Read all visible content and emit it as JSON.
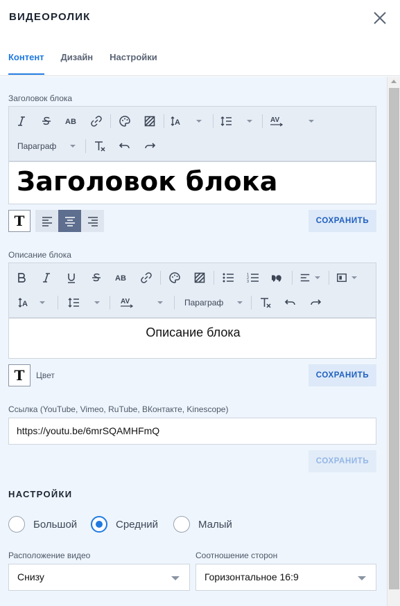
{
  "header": {
    "title": "ВИДЕОРОЛИК",
    "tabs": [
      {
        "label": "Контент",
        "active": true
      },
      {
        "label": "Дизайн",
        "active": false
      },
      {
        "label": "Настройки",
        "active": false
      }
    ]
  },
  "heading_block": {
    "label": "Заголовок блока",
    "paragraph_select": "Параграф",
    "text": "Заголовок блока",
    "save_label": "СОХРАНИТЬ",
    "text_color_icon": "T"
  },
  "description_block": {
    "label": "Описание блока",
    "paragraph_select": "Параграф",
    "text": "Описание блока",
    "color_label": "Цвет",
    "save_label": "СОХРАНИТЬ",
    "text_color_icon": "T"
  },
  "link": {
    "label": "Ссылка (YouTube, Vimeo, RuTube, ВКонтакте, Kinescope)",
    "value": "https://youtu.be/6mrSQAMHFmQ",
    "save_label": "СОХРАНИТЬ"
  },
  "settings": {
    "title": "НАСТРОЙКИ",
    "sizes": [
      {
        "label": "Большой",
        "selected": false
      },
      {
        "label": "Средний",
        "selected": true
      },
      {
        "label": "Малый",
        "selected": false
      }
    ],
    "video_position_label": "Расположение видео",
    "video_position_value": "Снизу",
    "aspect_ratio_label": "Соотношение сторон",
    "aspect_ratio_value": "Горизонтальное 16:9"
  },
  "colors": {
    "accent": "#1f7ae0",
    "panel_bg": "#eef5fd",
    "toolbar_bg": "#e7edf5",
    "align_active": "#5d6e8f"
  }
}
